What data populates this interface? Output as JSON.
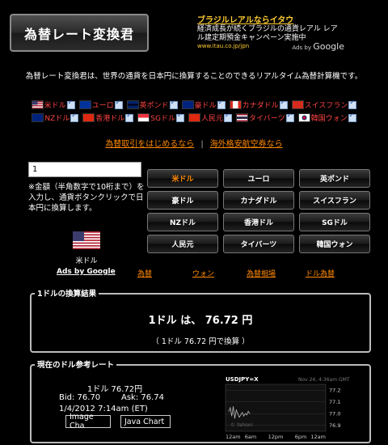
{
  "header": {
    "title": "為替レート変換君",
    "ad": {
      "title": "ブラジルレアルならイタウ",
      "line1": "経済成長が続くブラジルの通貨レアル レア",
      "line2": "ル建定期預金キャンペーン実施中",
      "url": "www.itau.co.jp/jpn",
      "by_label": "Ads by",
      "by_brand": "Google"
    }
  },
  "tagline": "為替レート変換君は、世界の通貨を日本円に換算することのできるリアルタイム為替計算機です。",
  "currency_links": {
    "row1": [
      "米ドル",
      "ユーロ",
      "英ポンド",
      "豪ドル",
      "カナダドル",
      "スイスフラン"
    ],
    "row2": [
      "NZドル",
      "香港ドル",
      "SGドル",
      "人民元",
      "タイバーツ",
      "韓国ウォン"
    ]
  },
  "links": {
    "fx_start": "為替取引をはじめるなら",
    "separator": "|",
    "flights": "海外格安航空券なら"
  },
  "converter": {
    "amount_value": "1",
    "instruction": "※金額（半角数字で10桁まで）を入力し、通貨ボタンクリックで日本円に換算します。",
    "selected_currency": "米ドル"
  },
  "buttons": [
    [
      "米ドル",
      "ユーロ",
      "英ポンド"
    ],
    [
      "豪ドル",
      "カナダドル",
      "スイスフラン"
    ],
    [
      "NZドル",
      "香港ドル",
      "SGドル"
    ],
    [
      "人民元",
      "タイバーツ",
      "韓国ウォン"
    ]
  ],
  "bottom_links": {
    "ads": "Ads by Google",
    "l1": "為替",
    "l2": "ウォン",
    "l3": "為替相場",
    "l4": "ドル為替"
  },
  "result": {
    "title": "1ドルの換算結果",
    "main": "1ドル は、 76.72 円",
    "sub": "（ 1ドル  76.72 円で換算 ）"
  },
  "reference": {
    "title": "現在のドル参考レート",
    "rate": "1ドル  76.72円",
    "bid": "Bid:  76.70",
    "ask": "Ask:  76.74",
    "time": "1/4/2012 7:14am (ET)",
    "image_btn": "Image Cha",
    "java_btn": "Java Chart"
  },
  "chart_data": {
    "type": "line",
    "title": "USDJPY=X",
    "date": "Nov 24, 4:36am GMT",
    "watermark": "© Yahoo!",
    "x_ticks": [
      "12am",
      "6am",
      "12pm",
      "6pm",
      "12am"
    ],
    "y_ticks": [
      77.2,
      77.1,
      77.0,
      76.9
    ],
    "ylim": [
      76.85,
      77.25
    ],
    "series": [
      {
        "values": [
          77.02,
          77.05,
          76.98,
          77.06,
          76.96,
          77.03,
          77.0,
          76.97,
          76.99,
          77.01,
          76.98,
          77.0,
          76.99,
          77.02,
          77.0
        ]
      }
    ]
  },
  "colors": {
    "link_red": "#ff4444",
    "link_orange": "#ff8800",
    "ad_gold": "#ffcc33"
  }
}
